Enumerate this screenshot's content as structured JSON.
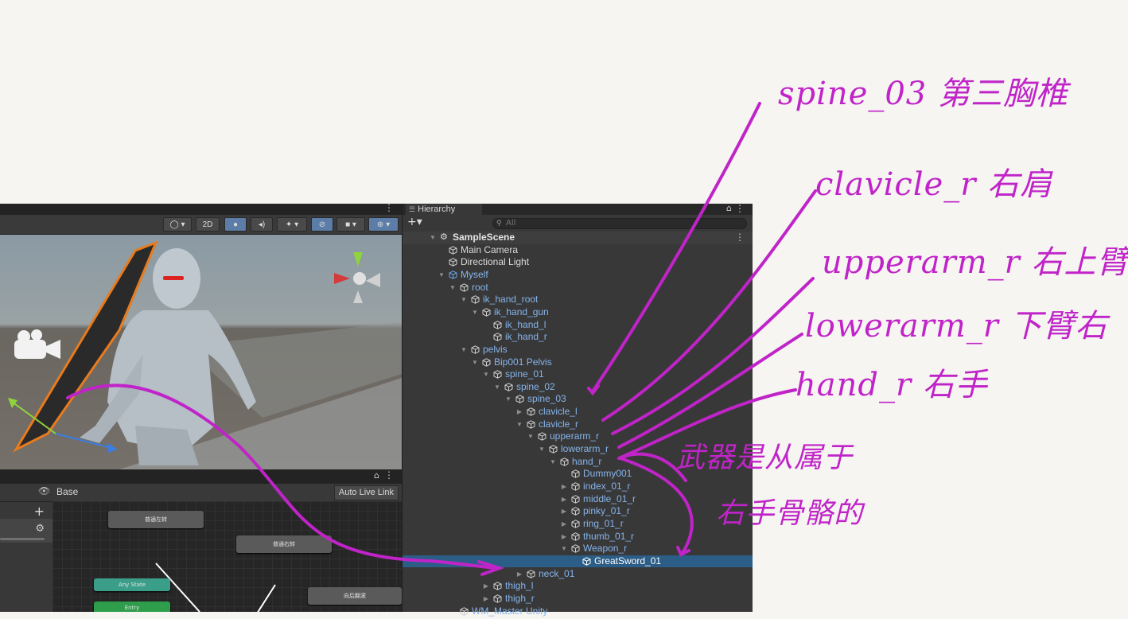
{
  "scene_view": {
    "toolbar": {
      "mode_2d_label": "2D"
    }
  },
  "animator": {
    "layer_name": "Base",
    "auto_live_link_label": "Auto Live Link",
    "add_label": "+",
    "nodes": {
      "left_turn": "普通左转",
      "right_turn": "普通右转",
      "backward_roll": "向后翻滚",
      "any_state": "Any State",
      "entry": "Entry"
    }
  },
  "hierarchy": {
    "tab_label": "Hierarchy",
    "add_label": "+▾",
    "search_placeholder": "All",
    "scene_name": "SampleScene",
    "items": [
      {
        "label": "Main Camera"
      },
      {
        "label": "Directional Light"
      },
      {
        "label": "Myself"
      },
      {
        "label": "root"
      },
      {
        "label": "ik_hand_root"
      },
      {
        "label": "ik_hand_gun"
      },
      {
        "label": "ik_hand_l"
      },
      {
        "label": "ik_hand_r"
      },
      {
        "label": "pelvis"
      },
      {
        "label": "Bip001 Pelvis"
      },
      {
        "label": "spine_01"
      },
      {
        "label": "spine_02"
      },
      {
        "label": "spine_03"
      },
      {
        "label": "clavicle_l"
      },
      {
        "label": "clavicle_r"
      },
      {
        "label": "upperarm_r"
      },
      {
        "label": "lowerarm_r"
      },
      {
        "label": "hand_r"
      },
      {
        "label": "Dummy001"
      },
      {
        "label": "index_01_r"
      },
      {
        "label": "middle_01_r"
      },
      {
        "label": "pinky_01_r"
      },
      {
        "label": "ring_01_r"
      },
      {
        "label": "thumb_01_r"
      },
      {
        "label": "Weapon_r"
      },
      {
        "label": "GreatSword_01"
      },
      {
        "label": "neck_01"
      },
      {
        "label": "thigh_l"
      },
      {
        "label": "thigh_r"
      },
      {
        "label": "WM_Master Unity"
      }
    ]
  },
  "annotations": {
    "spine": "spine_03 第三胸椎",
    "clavicle": "clavicle_r 右肩",
    "upperarm": "upperarm_r 右上臂",
    "lowerarm": "lowerarm_r 下臂右",
    "hand": "hand_r 右手",
    "weapon_note_1": "武器是从属于",
    "weapon_note_2": "右手骨骼的"
  },
  "colors": {
    "ink": "#c024c8",
    "selection": "#2c5d87",
    "hierarchy_bg": "#383838",
    "child_text": "#86b4ec"
  }
}
